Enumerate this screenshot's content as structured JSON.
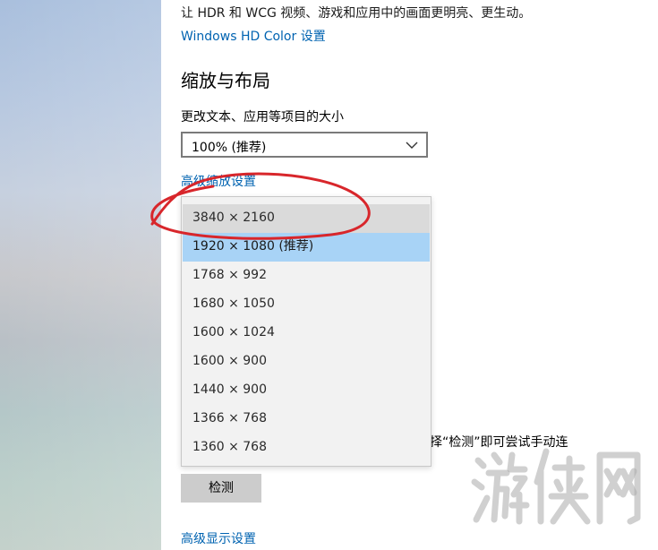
{
  "hdr": {
    "description": "让 HDR 和 WCG 视频、游戏和应用中的画面更明亮、更生动。",
    "link": "Windows HD Color 设置"
  },
  "scale_layout": {
    "title": "缩放与布局",
    "text_size_label": "更改文本、应用等项目的大小",
    "text_size_value": "100% (推荐)",
    "advanced_scaling_link": "高级缩放设置"
  },
  "resolution_dropdown": {
    "hovered_index": 0,
    "selected_index": 1,
    "options": [
      "3840 × 2160",
      "1920 × 1080 (推荐)",
      "1768 × 992",
      "1680 × 1050",
      "1600 × 1024",
      "1600 × 900",
      "1440 × 900",
      "1366 × 768",
      "1360 × 768"
    ]
  },
  "detect": {
    "partial_text": "选择“检测”即可尝试手动连",
    "button_label": "检测"
  },
  "advanced_display_link": "高级显示设置",
  "colors": {
    "link": "#0063b1",
    "selected_bg": "#a8d3f6",
    "hover_bg": "#dadada",
    "annotation": "#d8262b"
  },
  "watermark": "游侠网"
}
